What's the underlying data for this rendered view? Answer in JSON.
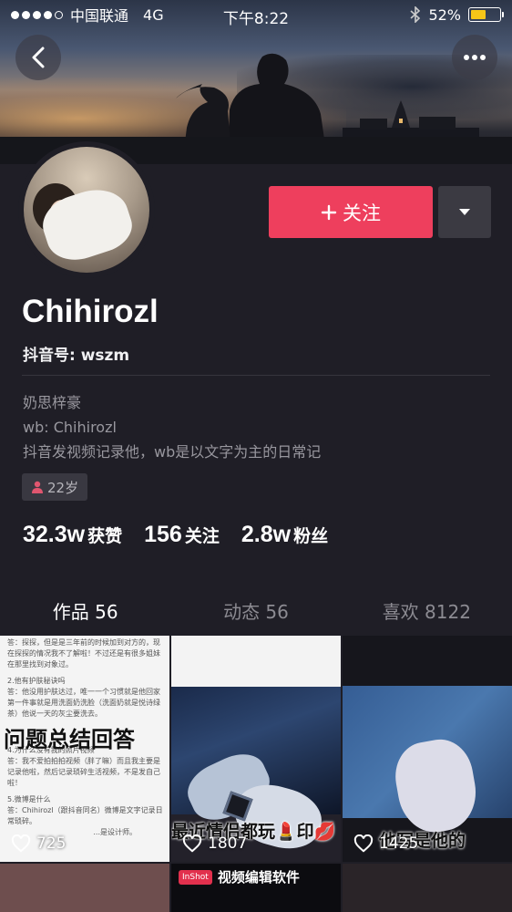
{
  "status_bar": {
    "carrier": "中国联通",
    "network": "4G",
    "time": "下午8:22",
    "battery_percent": "52%",
    "battery_level": 0.52
  },
  "header": {
    "back_icon": "chevron-left-icon",
    "more_icon": "more-dots-icon"
  },
  "profile": {
    "nickname": "Chihirozl",
    "douyin_id": "抖音号: wszm",
    "bio_lines": [
      "奶思梓豪",
      "wb: Chihirozl",
      "抖音发视频记录他，wb是以文字为主的日常记"
    ],
    "age_badge": "22岁",
    "follow_button": "关注",
    "stats": [
      {
        "value": "32.3w",
        "label": "获赞"
      },
      {
        "value": "156",
        "label": "关注"
      },
      {
        "value": "2.8w",
        "label": "粉丝"
      }
    ]
  },
  "tabs": [
    {
      "label": "作品 56",
      "active": true
    },
    {
      "label": "动态 56",
      "active": false
    },
    {
      "label": "喜欢 8122",
      "active": false
    }
  ],
  "videos": [
    {
      "title": "问题总结回答",
      "likes": "725",
      "doc_lines": [
        "答：探探，但是是三年前的时候加到对方的，现在探探的情况我不了解啦！不过还是有很多姐妹在那里找到对象过。",
        "2.他有护肤秘诀吗",
        "答：他没用护肤达过，唯一一个习惯就是他回家第一件事就是用洗面奶洗脸（洗面奶就是悦诗绿茶）他说一天的灰尘要洗去。",
        "4.为什么没有我的照片视频",
        "答：我不爱拍拍拍视频（胖了嘛）而且我主要是记录他啦，然后记录琐碎生活视频，不是发自己啦！",
        "5.微博是什么",
        "答：Chihirozl（跟抖音同名）微博是文字记录日常琐碎。",
        "...是设计师。"
      ]
    },
    {
      "title": "最近情侣都玩💄印💋",
      "likes": "1807"
    },
    {
      "title": "他写是他的",
      "likes": "1425"
    }
  ],
  "second_row": {
    "middle_badge": "InShot",
    "middle_caption": "视频编辑软件"
  },
  "colors": {
    "accent_red": "#ee3f5d",
    "tab_underline": "#f0d248",
    "background": "#1f1e26"
  }
}
